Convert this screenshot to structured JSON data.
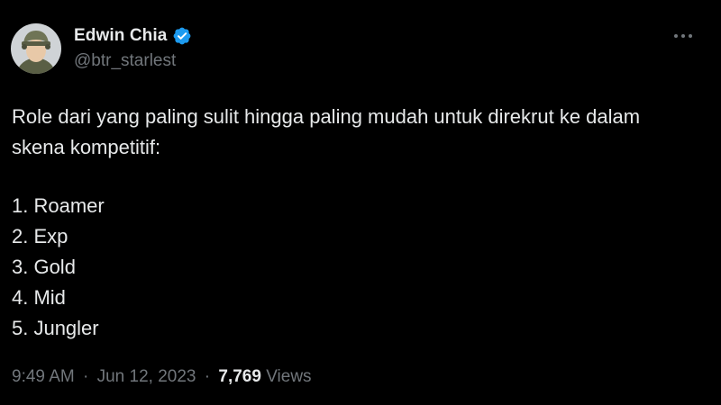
{
  "author": {
    "display_name": "Edwin Chia",
    "handle": "@btr_starlest",
    "verified_color": "#1d9bf0"
  },
  "tweet": {
    "lines": [
      "Role dari yang paling sulit hingga paling mudah untuk direkrut ke dalam",
      "skena kompetitif:"
    ],
    "list": [
      "1. Roamer",
      "2. Exp",
      "3. Gold",
      "4. Mid",
      "5. Jungler"
    ]
  },
  "meta": {
    "time": "9:49 AM",
    "separator": "·",
    "date": "Jun 12, 2023",
    "views_count": "7,769",
    "views_label": "Views"
  },
  "icons": {
    "verified": "verified-badge-icon",
    "more": "more-options-icon"
  },
  "colors": {
    "background": "#000000",
    "text_primary": "#e7e9ea",
    "text_secondary": "#71767b",
    "accent": "#1d9bf0"
  }
}
